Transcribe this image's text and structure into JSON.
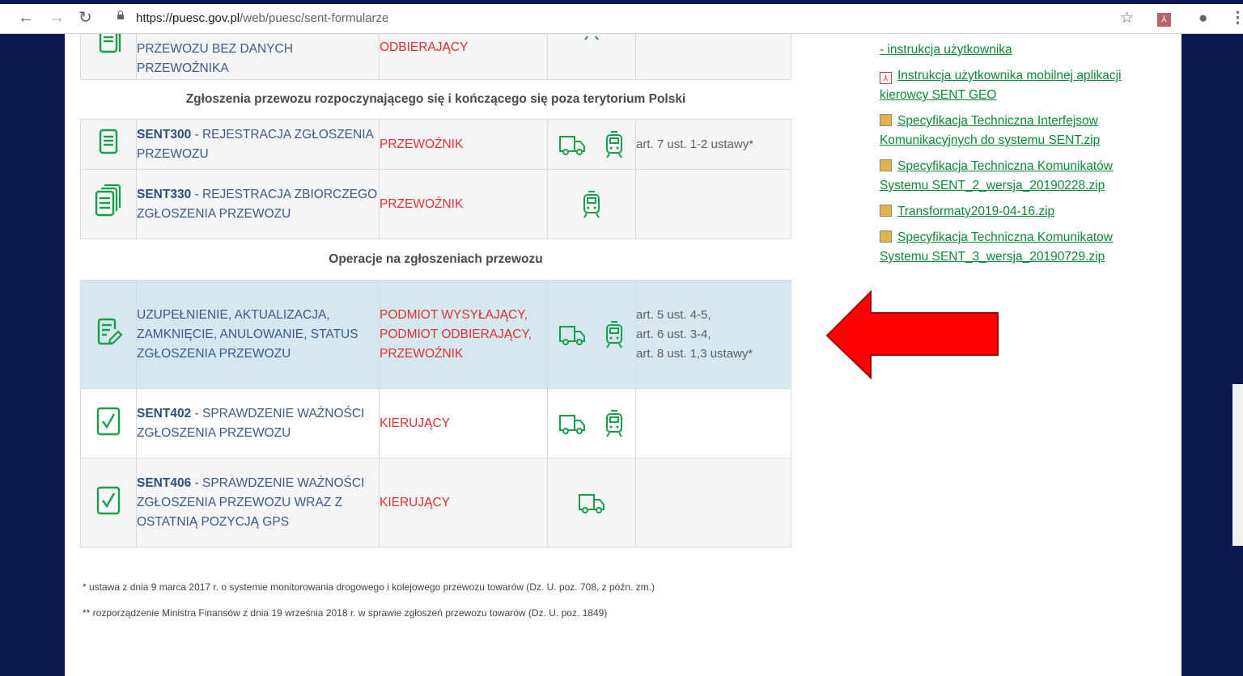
{
  "browser": {
    "url_host": "https://puesc.gov.pl",
    "url_path": "/web/puesc/sent-formularze"
  },
  "table": {
    "partial_row": {
      "name_lines": [
        "PRZEWOZU BEZ DANYCH",
        "PRZEWOŹNIKA"
      ],
      "role": "ODBIERAJĄCY"
    },
    "section1": "Zgłoszenia przewozu rozpoczynającego się i kończącego się poza terytorium Polski",
    "row_sent300": {
      "code": "SENT300",
      "name_rest": " - REJESTRACJA ZGŁOSZENIA PRZEWOZU",
      "role": "PRZEWOŹNIK",
      "law": "art. 7 ust. 1-2 ustawy*"
    },
    "row_sent330": {
      "code": "SENT330",
      "name_rest": " - REJESTRACJA ZBIORCZEGO ZGŁOSZENIA PRZEWOZU",
      "role": "PRZEWOŹNIK"
    },
    "section2": "Operacje na zgłoszeniach przewozu",
    "row_ops": {
      "name": "UZUPEŁNIENIE, AKTUALIZACJA, ZAMKNIĘCIE, ANULOWANIE, STATUS ZGŁOSZENIA PRZEWOZU",
      "role": "PODMIOT WYSYŁAJĄCY, PODMIOT ODBIERAJĄCY, PRZEWOŹNIK",
      "law_lines": [
        "art. 5 ust. 4-5,",
        "art. 6 ust. 3-4,",
        "art. 8 ust. 1,3 ustawy*"
      ]
    },
    "row_sent402": {
      "code": "SENT402",
      "name_rest": " - SPRAWDZENIE WAŻNOŚCI ZGŁOSZENIA PRZEWOZU",
      "role": "KIERUJĄCY"
    },
    "row_sent406": {
      "code": "SENT406",
      "name_rest": " - SPRAWDZENIE WAŻNOŚCI ZGŁOSZENIA PRZEWOZU WRAZ Z OSTATNIĄ POZYCJĄ GPS",
      "role": "KIERUJĄCY"
    }
  },
  "sidebar": {
    "links": [
      {
        "icon": "pdf",
        "text": "- instrukcja użytkownika"
      },
      {
        "icon": "pdf",
        "text": "Instrukcja użytkownika mobilnej aplikacji kierowcy SENT GEO"
      },
      {
        "icon": "zip",
        "text": "Specyfikacja Techniczna Interfejsow Komunikacyjnych do systemu SENT.zip"
      },
      {
        "icon": "zip",
        "text": "Specyfikacja Techniczna Komunikatów Systemu SENT_2_wersja_20190228.zip"
      },
      {
        "icon": "zip",
        "text": "Transformaty2019-04-16.zip"
      },
      {
        "icon": "zip",
        "text": "Specyfikacja Techniczna Komunikatow Systemu SENT_3_wersja_20190729.zip"
      }
    ]
  },
  "footnotes": {
    "f1": "* ustawa z dnia 9 marca 2017 r. o systemie monitorowania drogowego i kolejowego przewozu towarów (Dz. U. poz. 708, z późn. zm.)",
    "f2": "** rozporządzenie Ministra Finansów z dnia 19 września 2018 r. w sprawie zgłoszeń przewozu towarów (Dz. U. poz. 1849)"
  },
  "colors": {
    "accent_green": "#1a9e4a",
    "role_red": "#e0312f",
    "highlight_row": "#d5e8f0",
    "arrow_red": "#ff0000"
  }
}
